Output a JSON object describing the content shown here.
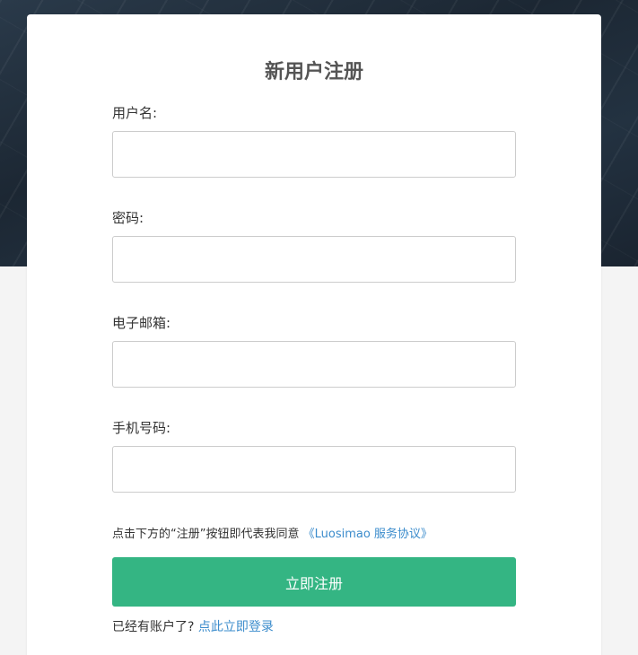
{
  "form": {
    "title": "新用户注册",
    "fields": [
      {
        "label": "用户名:",
        "value": "",
        "placeholder": ""
      },
      {
        "label": "密码:",
        "value": "",
        "placeholder": ""
      },
      {
        "label": "电子邮箱:",
        "value": "",
        "placeholder": ""
      },
      {
        "label": "手机号码:",
        "value": "",
        "placeholder": ""
      }
    ],
    "agreement_text": "点击下方的“注册”按钮即代表我同意",
    "agreement_link": "《Luosimao 服务协议》",
    "submit_label": "立即注册",
    "login_prompt": "已经有账户了?",
    "login_link": "点此立即登录"
  },
  "colors": {
    "accent": "#34b583",
    "link": "#3b8ccc",
    "title": "#555555",
    "hero_background": "#1f2b38",
    "page_background": "#f4f4f4"
  }
}
